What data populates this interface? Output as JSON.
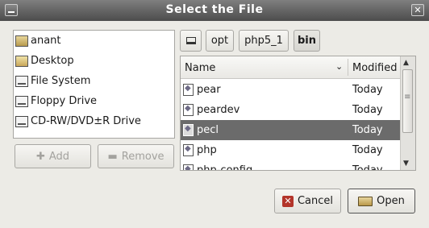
{
  "window": {
    "title": "Select the File",
    "close_glyph": "✕"
  },
  "places": [
    {
      "label": "anant",
      "icon": "home-folder-icon"
    },
    {
      "label": "Desktop",
      "icon": "desktop-icon"
    },
    {
      "label": "File System",
      "icon": "drive-icon"
    },
    {
      "label": "Floppy Drive",
      "icon": "drive-icon"
    },
    {
      "label": "CD-RW/DVD±R Drive",
      "icon": "drive-icon"
    }
  ],
  "place_buttons": {
    "add": "Add",
    "remove": "Remove"
  },
  "path": {
    "segments": [
      "opt",
      "php5_1",
      "bin"
    ]
  },
  "files": {
    "columns": {
      "name": "Name",
      "modified": "Modified"
    },
    "rows": [
      {
        "name": "pear",
        "modified": "Today",
        "selected": false
      },
      {
        "name": "peardev",
        "modified": "Today",
        "selected": false
      },
      {
        "name": "pecl",
        "modified": "Today",
        "selected": true
      },
      {
        "name": "php",
        "modified": "Today",
        "selected": false
      },
      {
        "name": "php-config",
        "modified": "Today",
        "selected": false
      }
    ]
  },
  "actions": {
    "cancel": "Cancel",
    "open": "Open"
  }
}
